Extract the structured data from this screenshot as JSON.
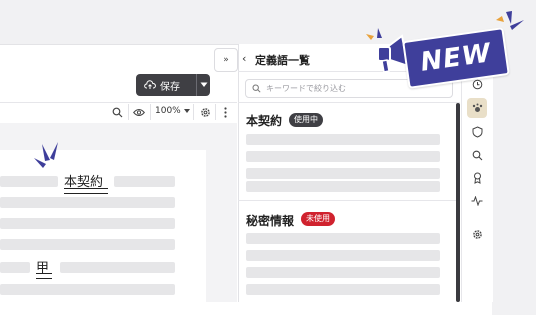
{
  "toolbar": {
    "save_label": "保存",
    "zoom_value": "100%"
  },
  "document": {
    "title": "本契約",
    "party": "甲"
  },
  "panel": {
    "title": "定義語一覧",
    "search_placeholder": "キーワードで絞り込む",
    "terms": [
      {
        "label": "本契約",
        "status": "使用中",
        "status_color": "#3f3f44"
      },
      {
        "label": "秘密情報",
        "status": "未使用",
        "status_color": "#d0222e"
      }
    ]
  },
  "badge": {
    "text": "NEW"
  },
  "icons": {
    "collapse": "chevron-double-right-icon",
    "back": "chevron-left-icon",
    "search": "search-icon",
    "eye": "eye-icon",
    "gear": "gear-icon",
    "more": "more-vertical-icon",
    "cloud": "cloud-upload-icon",
    "megaphone": "megaphone-icon"
  },
  "colors": {
    "accent_dark": "#3f3f44",
    "unused_red": "#d0222e",
    "new_badge": "#3f3f9b"
  }
}
